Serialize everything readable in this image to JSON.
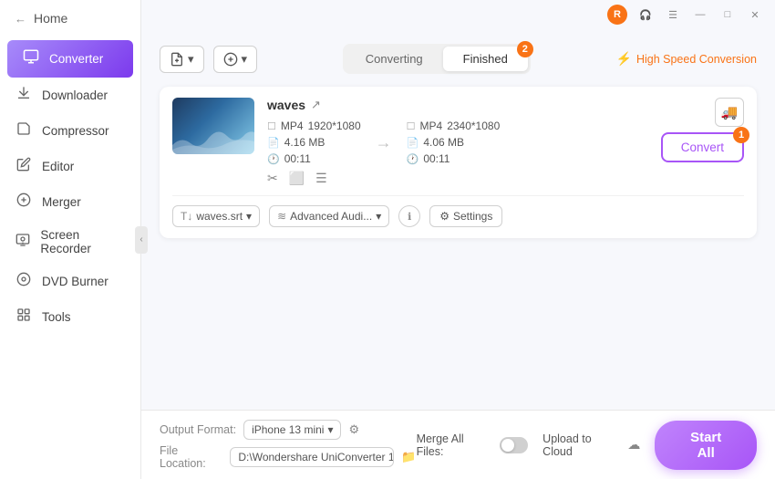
{
  "sidebar": {
    "home_label": "Home",
    "items": [
      {
        "id": "converter",
        "label": "Converter",
        "icon": "⚙",
        "active": true
      },
      {
        "id": "downloader",
        "label": "Downloader",
        "icon": "⬇"
      },
      {
        "id": "compressor",
        "label": "Compressor",
        "icon": "🗜"
      },
      {
        "id": "editor",
        "label": "Editor",
        "icon": "✂"
      },
      {
        "id": "merger",
        "label": "Merger",
        "icon": "⊕"
      },
      {
        "id": "screen-recorder",
        "label": "Screen Recorder",
        "icon": "⏺"
      },
      {
        "id": "dvd-burner",
        "label": "DVD Burner",
        "icon": "💿"
      },
      {
        "id": "tools",
        "label": "Tools",
        "icon": "⚒"
      }
    ]
  },
  "titlebar": {
    "avatar_letter": "R",
    "headphone_icon": "🎧",
    "menu_icon": "☰",
    "minimize_icon": "—",
    "maximize_icon": "□",
    "close_icon": "✕"
  },
  "toolbar": {
    "add_btn_label": "+",
    "add_caret": "▾",
    "convert_add_btn_label": "+",
    "convert_add_caret": "▾"
  },
  "tabs": {
    "converting_label": "Converting",
    "finished_label": "Finished",
    "finished_badge": "2",
    "active": "finished"
  },
  "high_speed": {
    "label": "High Speed Conversion"
  },
  "file": {
    "name": "waves",
    "input_format": "MP4",
    "input_resolution": "1920*1080",
    "input_size": "4.16 MB",
    "input_duration": "00:11",
    "output_format": "MP4",
    "output_resolution": "2340*1080",
    "output_size": "4.06 MB",
    "output_duration": "00:11",
    "subtitle": "waves.srt",
    "audio": "Advanced Audi...",
    "settings_label": "Settings",
    "convert_label": "Convert",
    "convert_badge": "1"
  },
  "bottom": {
    "output_format_label": "Output Format:",
    "output_format_value": "iPhone 13 mini",
    "file_location_label": "File Location:",
    "file_location_value": "D:\\Wondershare UniConverter 1",
    "merge_files_label": "Merge All Files:",
    "upload_cloud_label": "Upload to Cloud",
    "start_all_label": "Start All"
  },
  "edit_icons": {
    "cut": "✂",
    "crop": "⬜",
    "effects": "☰"
  }
}
